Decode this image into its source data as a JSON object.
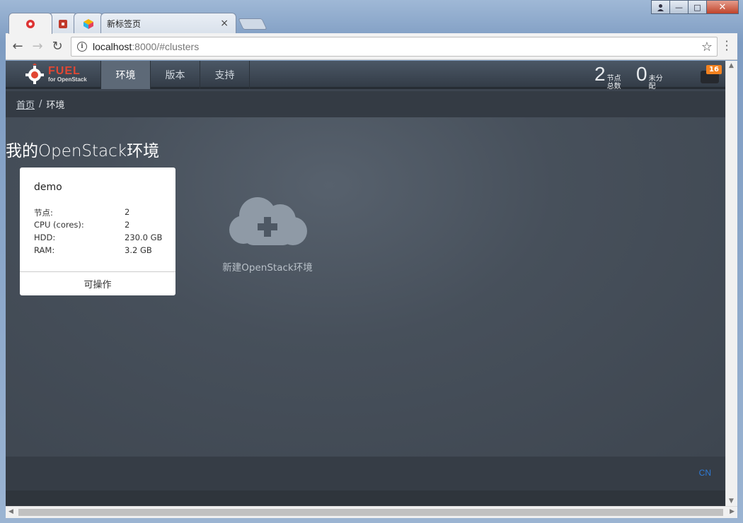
{
  "browser": {
    "tabs": [
      {
        "title": ""
      },
      {
        "title": ""
      },
      {
        "title": ""
      },
      {
        "title": "新标签页",
        "close": "×"
      }
    ],
    "url_host": "localhost",
    "url_rest": ":8000/#clusters",
    "window_controls": {
      "minimize": "—",
      "maximize": "□",
      "close": "✕"
    }
  },
  "fuel": {
    "logo_title": "FUEL",
    "logo_subtitle": "for OpenStack",
    "nav": [
      "环境",
      "版本",
      "支持"
    ],
    "stats": [
      {
        "num": "2",
        "label": "节点总数"
      },
      {
        "num": "0",
        "label": "未分配"
      }
    ],
    "notifications": "16"
  },
  "breadcrumb": {
    "home": "首页",
    "sep": "/",
    "current": "环境"
  },
  "page": {
    "title_a": "我的",
    "title_b": "OpenStack",
    "title_c": "环境"
  },
  "cluster": {
    "name": "demo",
    "rows": [
      {
        "k": "节点:",
        "v": "2"
      },
      {
        "k": "CPU (cores):",
        "v": "2"
      },
      {
        "k": "HDD:",
        "v": "230.0 GB"
      },
      {
        "k": "RAM:",
        "v": "3.2 GB"
      }
    ],
    "status": "可操作"
  },
  "new_cluster_label": "新建OpenStack环境",
  "footer": {
    "lang": "CN"
  },
  "colors": {
    "accent": "#e24733",
    "badge": "#f4821f",
    "link": "#2f7bd6"
  }
}
